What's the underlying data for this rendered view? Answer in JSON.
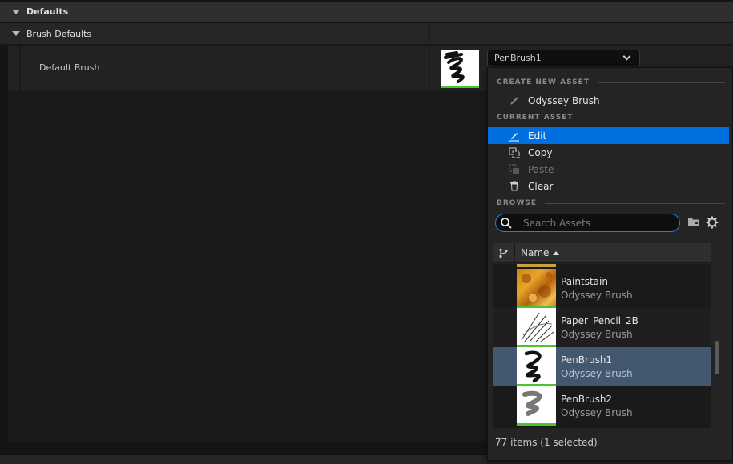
{
  "sections": {
    "defaults": "Defaults",
    "brush_defaults": "Brush Defaults"
  },
  "property": {
    "label": "Default Brush",
    "value": "PenBrush1"
  },
  "menu": {
    "create_new_asset_header": "CREATE NEW ASSET",
    "create_item": "Odyssey Brush",
    "current_asset_header": "CURRENT ASSET",
    "edit": "Edit",
    "copy": "Copy",
    "paste": "Paste",
    "clear": "Clear",
    "browse_header": "BROWSE",
    "search_placeholder": "Search Assets",
    "column_name": "Name",
    "items": [
      {
        "name": "Paintstain",
        "type": "Odyssey Brush",
        "thumb": "paintstain"
      },
      {
        "name": "Paper_Pencil_2B",
        "type": "Odyssey Brush",
        "thumb": "pencil"
      },
      {
        "name": "PenBrush1",
        "type": "Odyssey Brush",
        "thumb": "pen",
        "selected": true
      },
      {
        "name": "PenBrush2",
        "type": "Odyssey Brush",
        "thumb": "pen2"
      }
    ],
    "status": "77 items (1 selected)"
  },
  "colors": {
    "accent": "#0070e0",
    "selected_row": "#43576f",
    "thumb_underline": "#4dc42a"
  }
}
